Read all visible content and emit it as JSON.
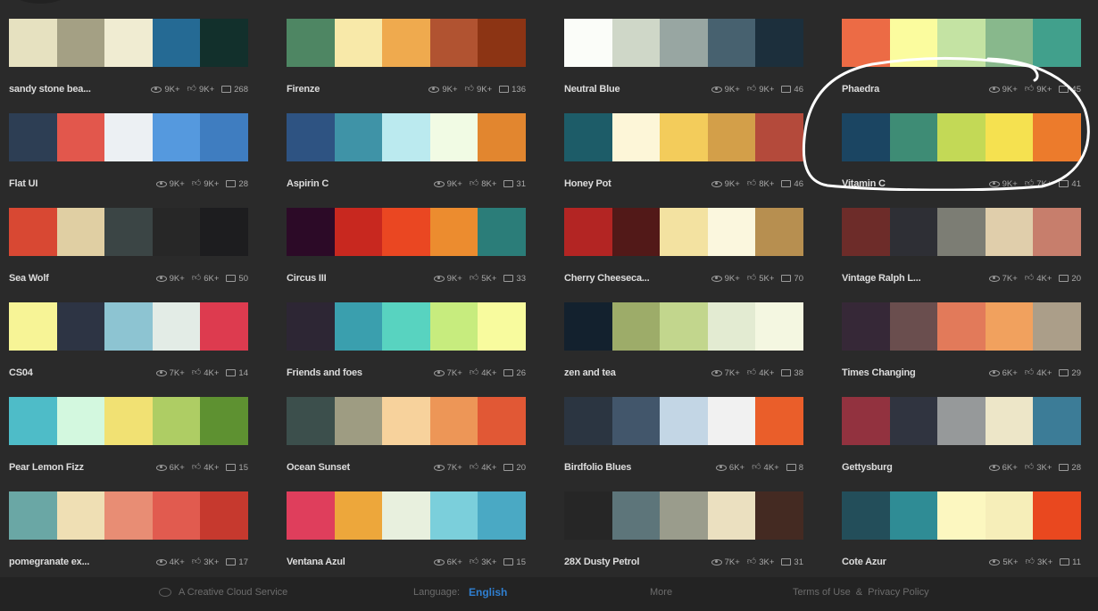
{
  "palettes": [
    {
      "name": "sandy stone bea...",
      "views": "9K+",
      "likes": "9K+",
      "comments": "268",
      "colors": [
        "#e6e1c0",
        "#a4a084",
        "#f0ecd2",
        "#256a94",
        "#12302c"
      ]
    },
    {
      "name": "Firenze",
      "views": "9K+",
      "likes": "9K+",
      "comments": "136",
      "colors": [
        "#4e8663",
        "#f8e9a9",
        "#efaa4e",
        "#b15331",
        "#8c3414"
      ]
    },
    {
      "name": "Neutral Blue",
      "views": "9K+",
      "likes": "9K+",
      "comments": "46",
      "colors": [
        "#fbfdf9",
        "#cfd7c8",
        "#98a6a2",
        "#47616f",
        "#1c2f3c"
      ]
    },
    {
      "name": "Phaedra",
      "views": "9K+",
      "likes": "9K+",
      "comments": "45",
      "colors": [
        "#ec6b45",
        "#fbfc9e",
        "#c4e3a3",
        "#88b88c",
        "#41a08c"
      ]
    },
    {
      "name": "Flat UI",
      "views": "9K+",
      "likes": "9K+",
      "comments": "28",
      "colors": [
        "#2d3e54",
        "#e2574c",
        "#ecf0f3",
        "#5599de",
        "#3f7dc0"
      ]
    },
    {
      "name": "Aspirin C",
      "views": "9K+",
      "likes": "8K+",
      "comments": "31",
      "colors": [
        "#2e5382",
        "#3f93a7",
        "#bbeaef",
        "#f1fbe4",
        "#e2862f"
      ]
    },
    {
      "name": "Honey Pot",
      "views": "9K+",
      "likes": "8K+",
      "comments": "46",
      "colors": [
        "#1d5c68",
        "#fdf6d8",
        "#f3cc5b",
        "#d39f49",
        "#b44a3b"
      ]
    },
    {
      "name": "Vitamin C",
      "views": "9K+",
      "likes": "7K+",
      "comments": "41",
      "colors": [
        "#1b4562",
        "#3e8c75",
        "#c3d956",
        "#f5e150",
        "#ec7b2c"
      ]
    },
    {
      "name": "Sea Wolf",
      "views": "9K+",
      "likes": "6K+",
      "comments": "50",
      "colors": [
        "#d84833",
        "#e0cfa3",
        "#3b4545",
        "#272727",
        "#1d1d1f"
      ]
    },
    {
      "name": "Circus III",
      "views": "9K+",
      "likes": "5K+",
      "comments": "33",
      "colors": [
        "#2c0a27",
        "#c8281f",
        "#ea4722",
        "#ec8c2f",
        "#2b7d79"
      ]
    },
    {
      "name": "Cherry Cheeseca...",
      "views": "9K+",
      "likes": "5K+",
      "comments": "70",
      "colors": [
        "#b32523",
        "#521918",
        "#f3e2a1",
        "#fbf7de",
        "#b78f50"
      ]
    },
    {
      "name": "Vintage Ralph L...",
      "views": "7K+",
      "likes": "4K+",
      "comments": "20",
      "colors": [
        "#6d2c29",
        "#2e2f35",
        "#7c7d74",
        "#e0ceab",
        "#c77e6c"
      ]
    },
    {
      "name": "CS04",
      "views": "7K+",
      "likes": "4K+",
      "comments": "14",
      "colors": [
        "#f7f496",
        "#2d3444",
        "#8dc4d2",
        "#e3ece6",
        "#dd3b4f"
      ]
    },
    {
      "name": "Friends and foes",
      "views": "7K+",
      "likes": "4K+",
      "comments": "26",
      "colors": [
        "#2d2634",
        "#3a9fae",
        "#58d3c0",
        "#c7ec7e",
        "#f8fb9e"
      ]
    },
    {
      "name": "zen and tea",
      "views": "7K+",
      "likes": "4K+",
      "comments": "38",
      "colors": [
        "#13212e",
        "#9dac69",
        "#c2d68d",
        "#e3ebd2",
        "#f4f7e1"
      ]
    },
    {
      "name": "Times Changing",
      "views": "6K+",
      "likes": "4K+",
      "comments": "29",
      "colors": [
        "#362837",
        "#6a4e4e",
        "#e27a5a",
        "#f1a15e",
        "#ab9e89"
      ]
    },
    {
      "name": "Pear Lemon Fizz",
      "views": "6K+",
      "likes": "4K+",
      "comments": "15",
      "colors": [
        "#4ebcc8",
        "#d3f8df",
        "#f1e173",
        "#aecd64",
        "#5e9131"
      ]
    },
    {
      "name": "Ocean Sunset",
      "views": "7K+",
      "likes": "4K+",
      "comments": "20",
      "colors": [
        "#3c4f4c",
        "#9e9c82",
        "#f7d29c",
        "#ed9657",
        "#e15835"
      ]
    },
    {
      "name": "Birdfolio Blues",
      "views": "6K+",
      "likes": "4K+",
      "comments": "8",
      "colors": [
        "#2b3541",
        "#42566b",
        "#c3d6e5",
        "#f1f1f1",
        "#ea5e2a"
      ]
    },
    {
      "name": "Gettysburg",
      "views": "6K+",
      "likes": "3K+",
      "comments": "28",
      "colors": [
        "#92323f",
        "#303440",
        "#96999a",
        "#ede6c8",
        "#3c7c97"
      ]
    },
    {
      "name": "pomegranate ex...",
      "views": "4K+",
      "likes": "3K+",
      "comments": "17",
      "colors": [
        "#6aa7a5",
        "#efdfb4",
        "#e88d74",
        "#e15b4f",
        "#c6392e"
      ]
    },
    {
      "name": "Ventana Azul",
      "views": "6K+",
      "likes": "3K+",
      "comments": "15",
      "colors": [
        "#df3e5c",
        "#eda73b",
        "#e8f0de",
        "#7bcfdb",
        "#4aa9c4"
      ]
    },
    {
      "name": "28X Dusty Petrol",
      "views": "7K+",
      "likes": "3K+",
      "comments": "31",
      "colors": [
        "#262626",
        "#5d757a",
        "#9a9c8c",
        "#ebe0c0",
        "#442a22"
      ]
    },
    {
      "name": "Cote Azur",
      "views": "5K+",
      "likes": "3K+",
      "comments": "11",
      "colors": [
        "#234e5a",
        "#2f8c95",
        "#fcf7c0",
        "#f6eeb9",
        "#e9481f"
      ]
    }
  ],
  "footer": {
    "service": "A Creative Cloud Service",
    "language_label": "Language:",
    "language_value": "English",
    "more": "More",
    "terms": "Terms of Use",
    "separator": "&",
    "privacy": "Privacy Policy"
  }
}
